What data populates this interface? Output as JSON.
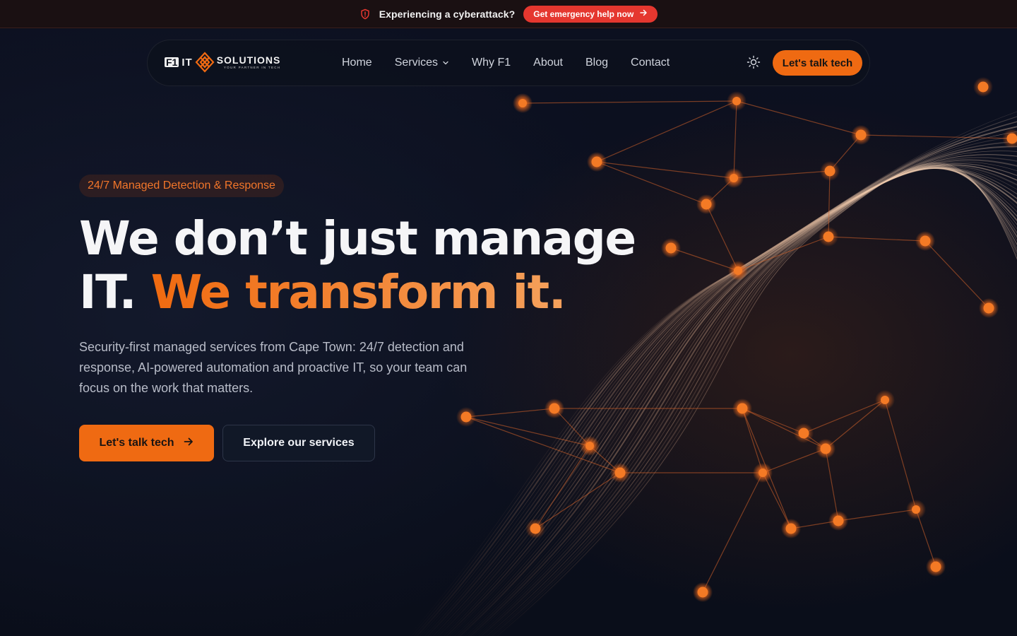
{
  "alert": {
    "icon": "shield-alert-icon",
    "text": "Experiencing a cyberattack?",
    "cta_label": "Get emergency help now",
    "cta_icon": "arrow-right-icon",
    "cta_color": "#e5372f"
  },
  "nav": {
    "logo": {
      "mark": "F1",
      "it": "IT",
      "wordmark": "SOLUTIONS",
      "tagline": "YOUR PARTNER IN TECH"
    },
    "links": [
      {
        "label": "Home"
      },
      {
        "label": "Services",
        "icon": "chevron-down-icon"
      },
      {
        "label": "Why F1"
      },
      {
        "label": "About"
      },
      {
        "label": "Blog"
      },
      {
        "label": "Contact"
      }
    ],
    "theme_toggle_icon": "sun-icon",
    "cta_label": "Let's talk tech"
  },
  "hero": {
    "badge": "24/7 Managed Detection & Response",
    "headline_line1": "We don’t just manage",
    "headline_plain": "IT. ",
    "headline_accent": "We transform it.",
    "lede": "Security-first managed services from Cape Town: 24/7 detection and response, AI-powered automation and proactive IT, so your team can focus on the work that matters.",
    "primary_cta": "Let's talk tech",
    "primary_cta_icon": "arrow-right-icon",
    "secondary_cta": "Explore our services"
  },
  "colors": {
    "accent": "#ef6a12",
    "background": "#0b0f1a",
    "alert": "#e5372f"
  }
}
